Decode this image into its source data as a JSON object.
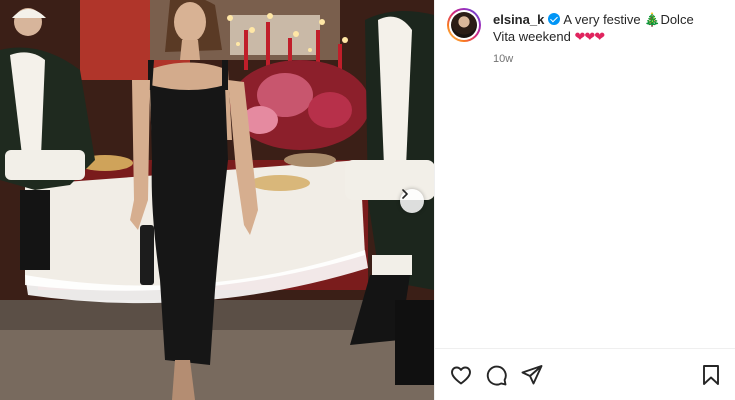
{
  "post": {
    "username": "elsina_k",
    "caption_prefix": "A very festive ",
    "caption_emoji_tree": "🎄",
    "caption_middle": "Dolce Vita weekend ",
    "caption_hearts": "❤❤❤",
    "timestamp": "10w",
    "verified": true
  },
  "icons": {
    "like": "heart-icon",
    "comment": "comment-icon",
    "share": "paper-plane-icon",
    "save": "bookmark-icon",
    "next": "chevron-right-icon"
  },
  "colors": {
    "verified_blue": "#0095f6",
    "heart_red": "#e0245e",
    "muted_text": "#737373"
  }
}
